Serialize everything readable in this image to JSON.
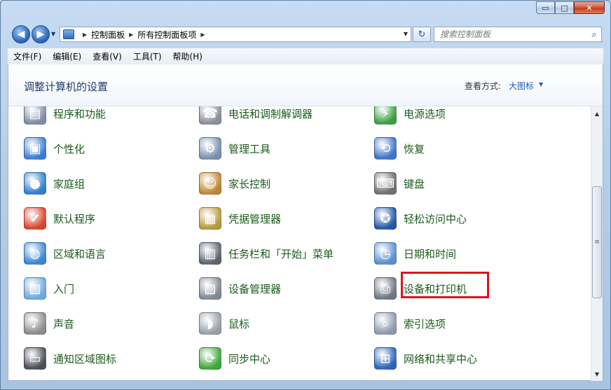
{
  "window": {
    "caption_buttons": {
      "minimize": "▭",
      "maximize": "□",
      "close": "✕"
    }
  },
  "nav": {
    "back_icon": "arrow-left-icon",
    "forward_icon": "arrow-right-icon",
    "breadcrumb": [
      "控制面板",
      "所有控制面板项"
    ],
    "search_placeholder": "搜索控制面板"
  },
  "menu": [
    "文件(F)",
    "编辑(E)",
    "查看(V)",
    "工具(T)",
    "帮助(H)"
  ],
  "header": {
    "title": "调整计算机的设置",
    "view_label": "查看方式:",
    "view_value": "大图标"
  },
  "items": [
    {
      "label": "程序和功能",
      "icon": "programs-icon",
      "color": "#7d8ea6"
    },
    {
      "label": "电话和调制解调器",
      "icon": "phone-modem-icon",
      "color": "#8a8f98"
    },
    {
      "label": "电源选项",
      "icon": "power-options-icon",
      "color": "#3aa040"
    },
    {
      "label": "个性化",
      "icon": "personalization-icon",
      "color": "#3b7fd4"
    },
    {
      "label": "管理工具",
      "icon": "admin-tools-icon",
      "color": "#7a90ad"
    },
    {
      "label": "恢复",
      "icon": "recovery-icon",
      "color": "#3d74c9"
    },
    {
      "label": "家庭组",
      "icon": "homegroup-icon",
      "color": "#2f7fd1"
    },
    {
      "label": "家长控制",
      "icon": "parental-controls-icon",
      "color": "#c0862e"
    },
    {
      "label": "键盘",
      "icon": "keyboard-icon",
      "color": "#6f6f6f"
    },
    {
      "label": "默认程序",
      "icon": "default-programs-icon",
      "color": "#d9452a"
    },
    {
      "label": "凭据管理器",
      "icon": "credential-manager-icon",
      "color": "#b49a3c"
    },
    {
      "label": "轻松访问中心",
      "icon": "ease-of-access-icon",
      "color": "#2457a6"
    },
    {
      "label": "区域和语言",
      "icon": "region-language-icon",
      "color": "#3a86d6"
    },
    {
      "label": "任务栏和「开始」菜单",
      "icon": "taskbar-icon",
      "color": "#5a6470"
    },
    {
      "label": "日期和时间",
      "icon": "date-time-icon",
      "color": "#5b8fd1"
    },
    {
      "label": "入门",
      "icon": "getting-started-icon",
      "color": "#6fa9dc"
    },
    {
      "label": "设备管理器",
      "icon": "device-manager-icon",
      "color": "#7f8a96"
    },
    {
      "label": "设备和打印机",
      "icon": "devices-printers-icon",
      "color": "#6e7784"
    },
    {
      "label": "声音",
      "icon": "sound-icon",
      "color": "#8c8c8c"
    },
    {
      "label": "鼠标",
      "icon": "mouse-icon",
      "color": "#9aa0a7"
    },
    {
      "label": "索引选项",
      "icon": "indexing-options-icon",
      "color": "#8a9bb0"
    },
    {
      "label": "通知区域图标",
      "icon": "notification-area-icon",
      "color": "#4a4f56"
    },
    {
      "label": "同步中心",
      "icon": "sync-center-icon",
      "color": "#3ea83a"
    },
    {
      "label": "网络和共享中心",
      "icon": "network-sharing-icon",
      "color": "#2a66b8"
    }
  ],
  "highlighted_item": "设备和打印机",
  "highlight_color": "#e0141a"
}
